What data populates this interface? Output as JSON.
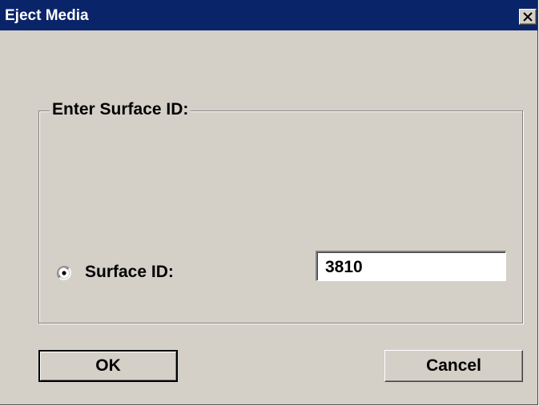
{
  "window": {
    "title": "Eject Media"
  },
  "group": {
    "label": "Enter Surface ID:"
  },
  "surface_radio": {
    "label": "Surface ID:",
    "selected": true
  },
  "surface_input": {
    "value": "3810"
  },
  "buttons": {
    "ok_label": "OK",
    "cancel_label": "Cancel"
  },
  "icons": {
    "close": "close-icon",
    "radio": "radio-selected-icon"
  },
  "colors": {
    "titlebar": "#0a246a",
    "face": "#d4d0c8"
  }
}
